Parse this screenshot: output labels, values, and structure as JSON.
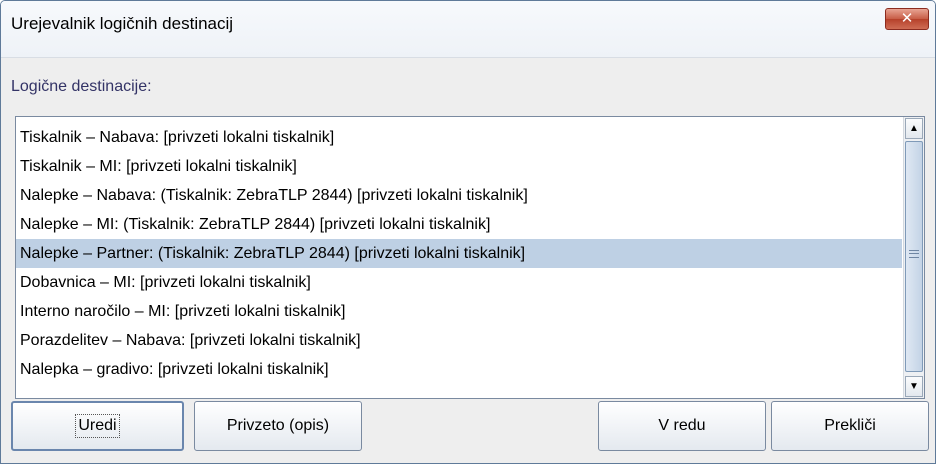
{
  "window": {
    "title": "Urejevalnik logičnih destinacij",
    "close_symbol": "✕"
  },
  "section_label": "Logične destinacije:",
  "list": {
    "items": [
      "Tiskalnik – Nabava: [privzeti lokalni tiskalnik]",
      "Tiskalnik – MI: [privzeti lokalni tiskalnik]",
      "Nalepke – Nabava: (Tiskalnik: ZebraTLP 2844) [privzeti lokalni tiskalnik]",
      "Nalepke – MI: (Tiskalnik: ZebraTLP 2844) [privzeti lokalni tiskalnik]",
      "Nalepke – Partner: (Tiskalnik: ZebraTLP 2844) [privzeti lokalni tiskalnik]",
      "Dobavnica – MI: [privzeti lokalni tiskalnik]",
      "Interno naročilo – MI: [privzeti lokalni tiskalnik]",
      "Porazdelitev – Nabava: [privzeti lokalni tiskalnik]",
      "Nalepka – gradivo: [privzeti lokalni tiskalnik]"
    ],
    "selected_index": 4
  },
  "buttons": {
    "edit": "Uredi",
    "default_desc": "Privzeto (opis)",
    "ok": "V redu",
    "cancel": "Prekliči"
  },
  "icons": {
    "close": "close-icon",
    "scroll_up": "scroll-up-arrow-icon",
    "scroll_down": "scroll-down-arrow-icon"
  },
  "colors": {
    "selection": "#bed0e4",
    "label_text": "#333366",
    "close_button": "#c75c45"
  }
}
